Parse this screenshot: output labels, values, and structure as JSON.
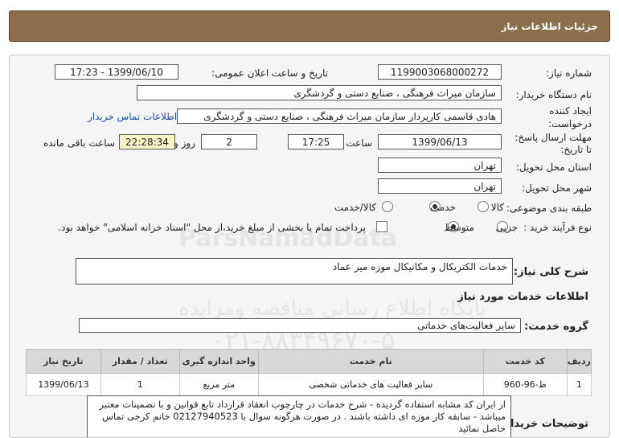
{
  "header": {
    "title": "جزئیات اطلاعات نیاز"
  },
  "form": {
    "need_number_label": "شماره نیاز:",
    "need_number": "1199003068000272",
    "announce_label": "تاریخ و ساعت اعلان عمومی:",
    "announce_value": "1399/06/10 - 17:23",
    "buyer_org_label": "نام دستگاه خریدار:",
    "buyer_org": "سازمان میراث فرهنگی ، صنایع دستی و گردشگری",
    "creator_label_1": "ایجاد کننده",
    "creator_label_2": "درخواست:",
    "creator": "هادی قاسمی کارپرداز سازمان میراث فرهنگی ، صنایع دستی و گردشگری",
    "contact_link": "اطلاعات تماس خریدار",
    "deadline_label_1": "مهلت ارسال پاسخ:",
    "deadline_label_2": "تا تاریخ:",
    "deadline_date": "1399/06/13",
    "time_label": "ساعت",
    "deadline_time": "17:25",
    "days": "2",
    "days_label": "روز و",
    "remaining": "22:28:34",
    "remaining_label": "ساعت باقی مانده",
    "province_label": "استان محل تحویل:",
    "province": "تهران",
    "city_label": "شهر محل تحویل:",
    "city": "تهران",
    "category_label": "طبقه بندی موضوعی:",
    "category_options": [
      "کالا",
      "خدمت",
      "کالا/خدمت"
    ],
    "process_label": "نوع فرآیند خرید :",
    "process_options": [
      "جزیی",
      "متوسط"
    ],
    "payment_note": "پرداخت تمام یا بخشی از مبلغ خرید،از محل \"اسناد خزانه اسلامی\" خواهد بود."
  },
  "summary": {
    "label": "شرح کلی نیاز:",
    "value": "خدمات الکتریکال و مکانیکال موزه میر عماد"
  },
  "services": {
    "section_title": "اطلاعات خدمات مورد نیاز",
    "group_label": "گروه خدمت:",
    "group_value": "سایر فعالیت‌های خدماتی",
    "columns": [
      "ردیف",
      "کد خدمت",
      "نام خدمت",
      "واحد اندازه گیری",
      "تعداد / مقدار",
      "تاریخ نیاز"
    ],
    "rows": [
      [
        "1",
        "ط-96-960",
        "سایر فعالیت های خدماتی شخصی",
        "متر مربع",
        "1",
        "1399/06/13"
      ]
    ]
  },
  "buyer_notes": {
    "label": "توضیحات خریدار:",
    "text": "از ایران کد مشابه استفاده گردیده - شرح خدمات در چارچوب انعقاد قرارداد تابع قوانین و با تضمینات معتبر میباشد - سابقه کار موزه ای داشته باشند . در صورت هرگونه سوال با 02127940523 خانم کرجی تماس حاصل نمائید"
  },
  "watermark": {
    "line1": "ParsNamadData",
    "line2": "مرکز فراوری اطلاعات پارس نماد داده ها",
    "line3": "پایگاه اطلاع رسانی مناقصه ومزایده",
    "line4": "۰۲۱-۸۸۳۴۹۶۷۰-۵"
  }
}
